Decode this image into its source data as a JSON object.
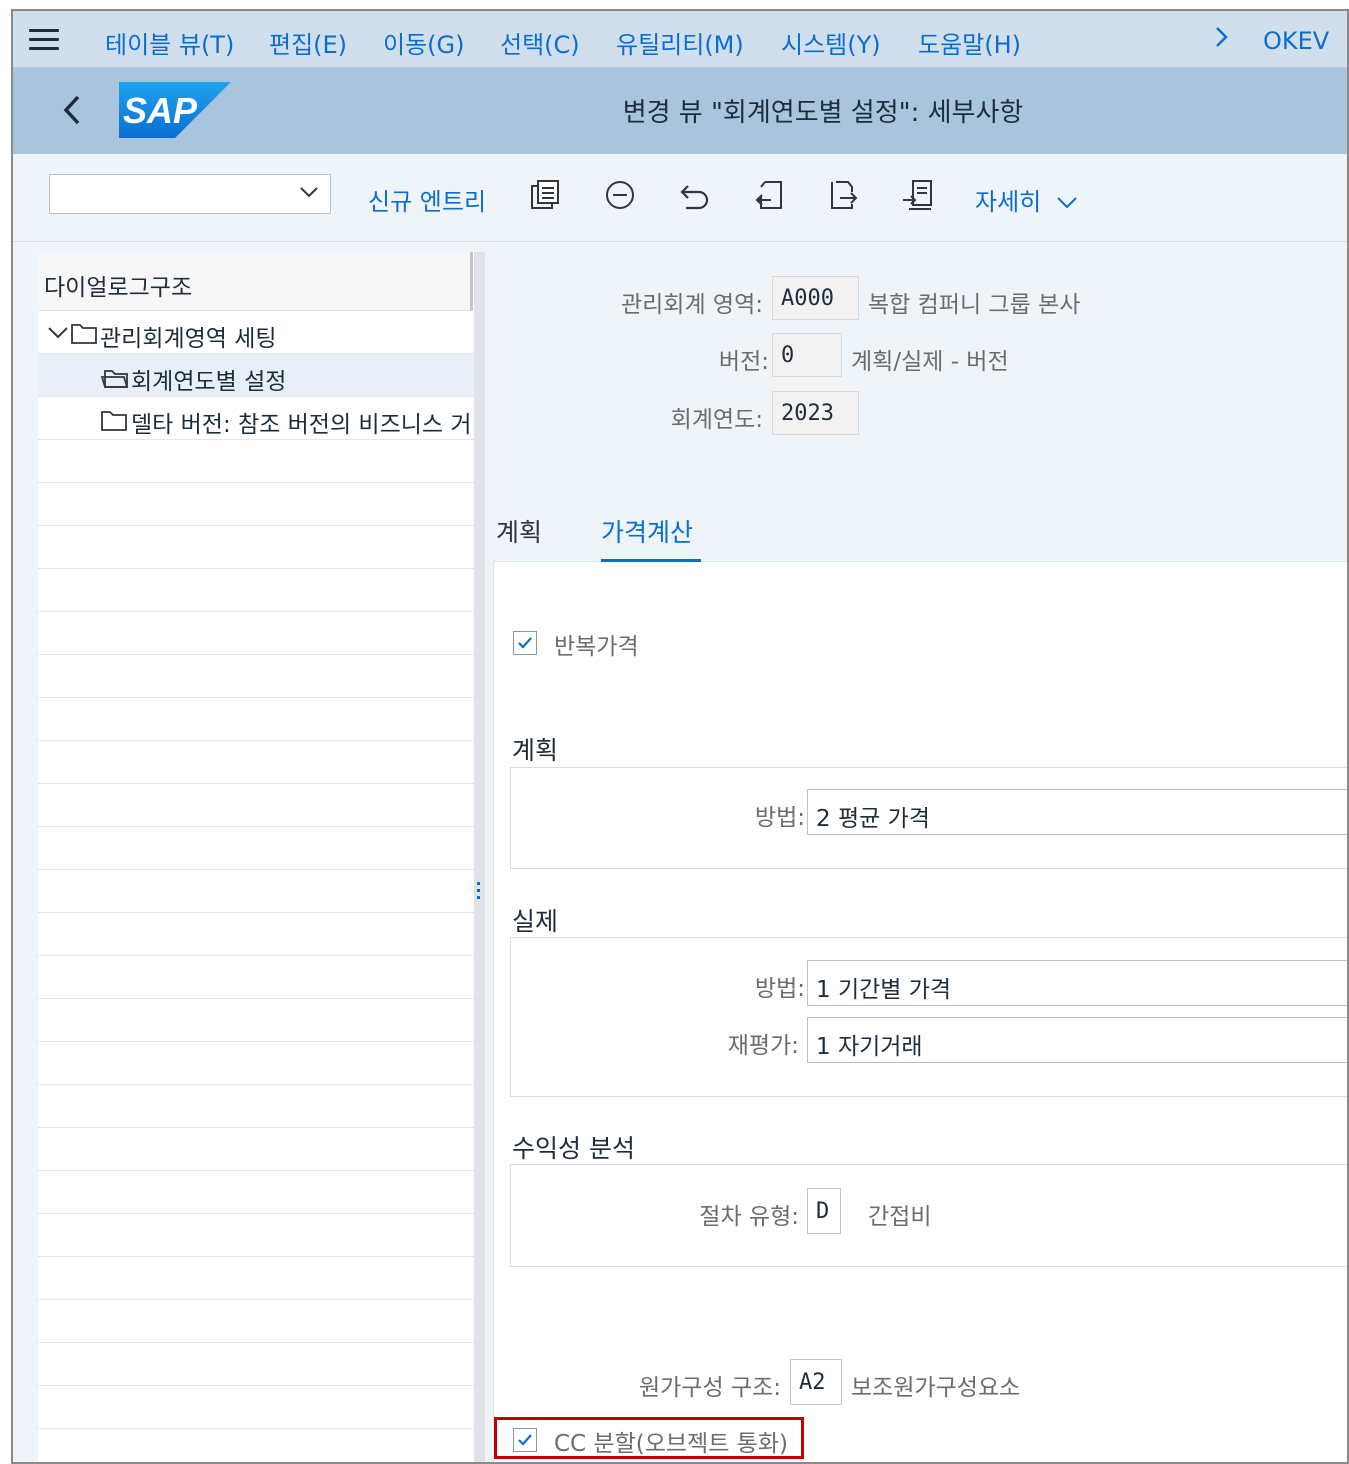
{
  "menubar": {
    "items": [
      "테이블 뷰(T)",
      "편집(E)",
      "이동(G)",
      "선택(C)",
      "유틸리티(M)",
      "시스템(Y)",
      "도움말(H)"
    ],
    "system_id": "OKEV"
  },
  "titlebar": {
    "logo_text": "SAP",
    "title": "변경 뷰 \"회계연도별 설정\": 세부사항"
  },
  "toolbar": {
    "command_value": "",
    "new_entries": "신규 엔트리",
    "more": "자세히"
  },
  "tree": {
    "header": "다이얼로그구조",
    "items": [
      {
        "label": "관리회계영역 세팅",
        "expanded": true
      },
      {
        "label": "회계연도별 설정",
        "selected": true
      },
      {
        "label": "델타 버전: 참조 버전의 비즈니스 거"
      }
    ]
  },
  "header_fields": {
    "controlling_area_label": "관리회계 영역:",
    "controlling_area_value": "A000",
    "controlling_area_desc": "복합 컴퍼니 그룹 본사",
    "version_label": "버전:",
    "version_value": "0",
    "version_desc": "계획/실제 - 버전",
    "fiscal_year_label": "회계연도:",
    "fiscal_year_value": "2023"
  },
  "tabs": [
    {
      "label": "계획",
      "active": false
    },
    {
      "label": "가격계산",
      "active": true
    }
  ],
  "pricing": {
    "recurring_price_label": "반복가격",
    "recurring_price_checked": true,
    "plan": {
      "title": "계획",
      "method_label": "방법:",
      "method_value": "2 평균 가격"
    },
    "actual": {
      "title": "실제",
      "method_label": "방법:",
      "method_value": "1 기간별 가격",
      "revaluation_label": "재평가:",
      "revaluation_value": "1 자기거래"
    },
    "profitability": {
      "title": "수익성 분석",
      "procedure_label": "절차 유형:",
      "procedure_value": "D",
      "procedure_desc": "간접비"
    },
    "cost_component_label": "원가구성 구조:",
    "cost_component_value": "A2",
    "cost_component_desc": "보조원가구성요소",
    "cc_split_label": "CC 분할(오브젝트 통화)",
    "cc_split_checked": true
  },
  "colors": {
    "accent": "#0a6ed1",
    "menubar_bg": "#d1deeb",
    "titlebar_bg": "#a9c4dd",
    "highlight": "#c00000"
  }
}
